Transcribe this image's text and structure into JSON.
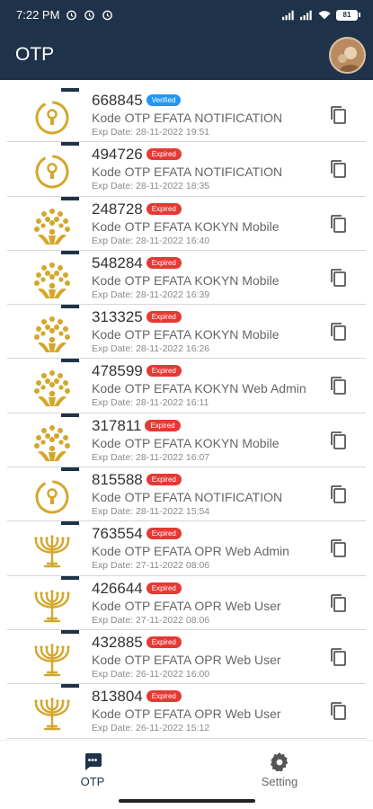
{
  "status_bar": {
    "time": "7:22 PM",
    "battery": "81"
  },
  "app_bar": {
    "title": "OTP"
  },
  "otp_items": [
    {
      "code": "668845",
      "status": "Verified",
      "description": "Kode OTP EFATA NOTIFICATION",
      "exp_date": "Exp Date: 28-11-2022 19:51",
      "logo": "keyhole-icon"
    },
    {
      "code": "494726",
      "status": "Expired",
      "description": "Kode OTP EFATA NOTIFICATION",
      "exp_date": "Exp Date: 28-11-2022 18:35",
      "logo": "keyhole-icon"
    },
    {
      "code": "248728",
      "status": "Expired",
      "description": "Kode OTP EFATA KOKYN Mobile",
      "exp_date": "Exp Date: 28-11-2022 16:40",
      "logo": "tree-icon"
    },
    {
      "code": "548284",
      "status": "Expired",
      "description": "Kode OTP EFATA KOKYN Mobile",
      "exp_date": "Exp Date: 28-11-2022 16:39",
      "logo": "tree-icon"
    },
    {
      "code": "313325",
      "status": "Expired",
      "description": "Kode OTP EFATA KOKYN Mobile",
      "exp_date": "Exp Date: 28-11-2022 16:26",
      "logo": "tree-icon"
    },
    {
      "code": "478599",
      "status": "Expired",
      "description": "Kode OTP EFATA KOKYN Web Admin",
      "exp_date": "Exp Date: 28-11-2022 16:11",
      "logo": "tree-icon"
    },
    {
      "code": "317811",
      "status": "Expired",
      "description": "Kode OTP EFATA KOKYN Mobile",
      "exp_date": "Exp Date: 28-11-2022 16:07",
      "logo": "tree-icon"
    },
    {
      "code": "815588",
      "status": "Expired",
      "description": "Kode OTP EFATA NOTIFICATION",
      "exp_date": "Exp Date: 28-11-2022 15:54",
      "logo": "keyhole-icon"
    },
    {
      "code": "763554",
      "status": "Expired",
      "description": "Kode OTP EFATA OPR Web Admin",
      "exp_date": "Exp Date: 27-11-2022 08:06",
      "logo": "menorah-icon"
    },
    {
      "code": "426644",
      "status": "Expired",
      "description": "Kode OTP EFATA OPR Web User",
      "exp_date": "Exp Date: 27-11-2022 08:06",
      "logo": "menorah-icon"
    },
    {
      "code": "432885",
      "status": "Expired",
      "description": "Kode OTP EFATA OPR Web User",
      "exp_date": "Exp Date: 26-11-2022 16:00",
      "logo": "menorah-icon"
    },
    {
      "code": "813804",
      "status": "Expired",
      "description": "Kode OTP EFATA OPR Web User",
      "exp_date": "Exp Date: 26-11-2022 15:12",
      "logo": "menorah-icon"
    }
  ],
  "bottom_nav": {
    "otp_label": "OTP",
    "setting_label": "Setting"
  },
  "colors": {
    "appbar": "#1e3349",
    "gold": "#d4a72c",
    "verified": "#2196f3",
    "expired": "#e53935"
  }
}
